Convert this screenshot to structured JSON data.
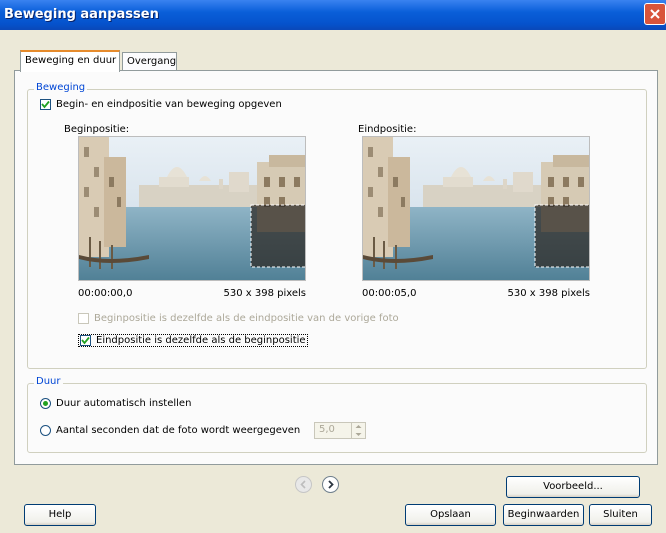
{
  "window": {
    "title": "Beweging aanpassen"
  },
  "tabs": [
    {
      "label": "Beweging en duur",
      "active": true
    },
    {
      "label": "Overgang",
      "active": false
    }
  ],
  "beweging": {
    "legend": "Beweging",
    "record_checkbox": {
      "label": "Begin- en eindpositie van beweging opgeven",
      "checked": true
    },
    "start": {
      "heading": "Beginpositie:",
      "time": "00:00:00,0",
      "size": "530 x 398 pixels"
    },
    "end": {
      "heading": "Eindpositie:",
      "time": "00:00:05,0",
      "size": "530 x 398 pixels"
    },
    "same_as_previous": {
      "label": "Beginpositie is dezelfde als de eindpositie van de vorige foto",
      "checked": false,
      "enabled": false
    },
    "end_same_as_start": {
      "label": "Eindpositie is dezelfde als de beginpositie",
      "checked": true
    }
  },
  "duur": {
    "legend": "Duur",
    "auto": {
      "label": "Duur automatisch instellen",
      "selected": true
    },
    "seconds": {
      "label": "Aantal seconden dat de foto wordt weergegeven",
      "selected": false
    },
    "seconds_value": "5,0"
  },
  "buttons": {
    "preview": "Voorbeeld...",
    "help": "Help",
    "save": "Opslaan",
    "defaults": "Beginwaarden",
    "close": "Sluiten"
  },
  "icons": {
    "close": "close-icon",
    "prev": "arrow-left-icon",
    "next": "arrow-right-icon"
  },
  "colors": {
    "titlebar": "#0552cc",
    "accent": "#0046d5",
    "checkmark": "#21a121"
  }
}
